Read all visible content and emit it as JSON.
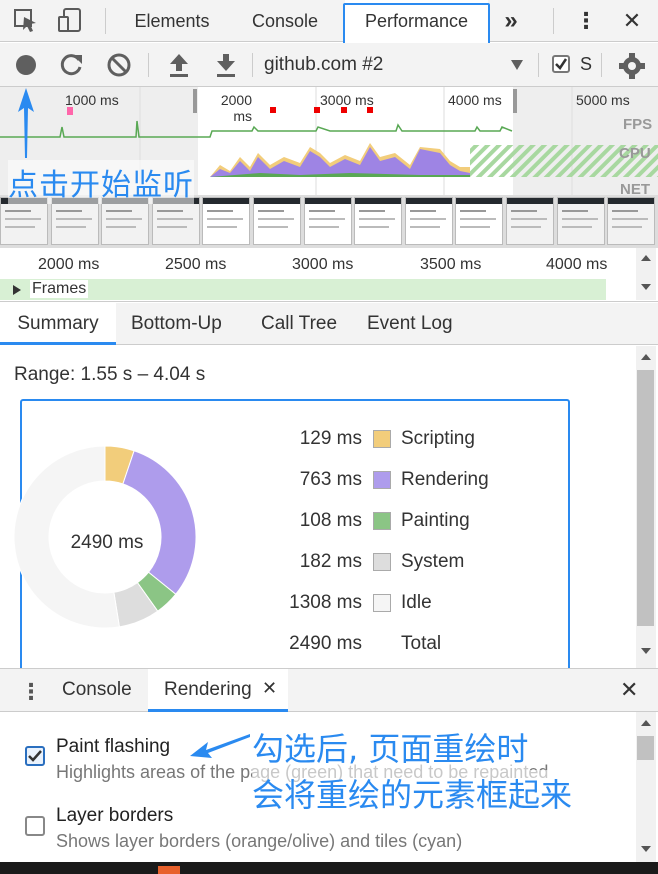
{
  "tabs": {
    "elements": "Elements",
    "console": "Console",
    "performance": "Performance",
    "more": "»",
    "menu": "⋮",
    "close": "✕"
  },
  "toolbar": {
    "profile_select": "github.com #2",
    "screenshots_checkbox_label": "S"
  },
  "overview": {
    "ticks": [
      "1000 ms",
      "2000 ms",
      "3000 ms",
      "4000 ms",
      "5000 ms"
    ],
    "track_labels": [
      "FPS",
      "CPU",
      "NET"
    ]
  },
  "flame": {
    "ticks": [
      "2000 ms",
      "2500 ms",
      "3000 ms",
      "3500 ms",
      "4000 ms"
    ],
    "frames_label": "Frames"
  },
  "subtabs": [
    "Summary",
    "Bottom-Up",
    "Call Tree",
    "Event Log"
  ],
  "summary": {
    "range": "Range: 1.55 s – 4.04 s",
    "total_center": "2490 ms",
    "rows": [
      {
        "value": "129 ms",
        "label": "Scripting",
        "color": "#f2cd7b"
      },
      {
        "value": "763 ms",
        "label": "Rendering",
        "color": "#ae9cec"
      },
      {
        "value": "108 ms",
        "label": "Painting",
        "color": "#8bc585"
      },
      {
        "value": "182 ms",
        "label": "System",
        "color": "#dddddd"
      },
      {
        "value": "1308 ms",
        "label": "Idle",
        "color": "#f5f5f5"
      },
      {
        "value": "2490 ms",
        "label": "Total",
        "color": ""
      }
    ]
  },
  "drawer": {
    "tab_console": "Console",
    "tab_rendering": "Rendering",
    "options": [
      {
        "title": "Paint flashing",
        "desc": "Highlights areas of the page (green) that need to be repainted",
        "checked": true
      },
      {
        "title": "Layer borders",
        "desc": "Shows layer borders (orange/olive) and tiles (cyan)",
        "checked": false
      }
    ]
  },
  "annotations": {
    "start": "点击开始监听",
    "paint_line1": "勾选后, 页面重绘时",
    "paint_line2": "会将重绘的元素框起来"
  },
  "colors": {
    "accent": "#2a8af0",
    "scripting": "#f2cd7b",
    "rendering": "#ae9cec",
    "painting": "#8bc585",
    "system": "#dddddd",
    "idle": "#f5f5f5"
  }
}
